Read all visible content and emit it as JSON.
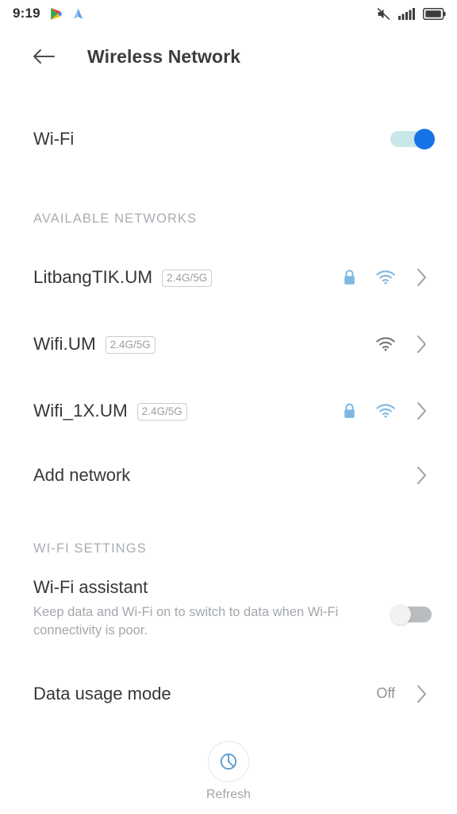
{
  "statusbar": {
    "time": "9:19",
    "left_icons": [
      "google-play-icon",
      "navigation-arrow-icon"
    ],
    "right_icons": [
      "volume-muted-icon",
      "signal-bars-icon",
      "battery-icon"
    ]
  },
  "appbar": {
    "back_icon": "back-arrow-icon",
    "title": "Wireless Network"
  },
  "wifi": {
    "label": "Wi-Fi",
    "enabled": "on"
  },
  "available_networks": {
    "section_label": "AVAILABLE NETWORKS",
    "items": [
      {
        "name": "LitbangTIK.UM",
        "badge": "2.4G/5G",
        "secured": "yes",
        "signal": "strong",
        "wifi_color": "#7db8e2"
      },
      {
        "name": "Wifi.UM",
        "badge": "2.4G/5G",
        "secured": "no",
        "signal": "strong",
        "wifi_color": "#6f767c"
      },
      {
        "name": "Wifi_1X.UM",
        "badge": "2.4G/5G",
        "secured": "yes",
        "signal": "strong",
        "wifi_color": "#7db8e2"
      }
    ],
    "add_network_label": "Add network"
  },
  "wifi_settings": {
    "section_label": "WI-FI SETTINGS",
    "assistant": {
      "title": "Wi-Fi assistant",
      "subtitle": "Keep data and Wi-Fi on to switch to data when Wi-Fi connectivity is poor.",
      "enabled": "off"
    },
    "data_usage": {
      "title": "Data usage mode",
      "value": "Off"
    }
  },
  "footer": {
    "refresh_label": "Refresh",
    "refresh_icon": "refresh-icon"
  },
  "colors": {
    "accent_blue": "#1473e6",
    "icon_blue": "#7db8e2",
    "text_primary": "#35383b",
    "text_secondary": "#a3a8ad",
    "chevron": "#9aa0a6"
  }
}
